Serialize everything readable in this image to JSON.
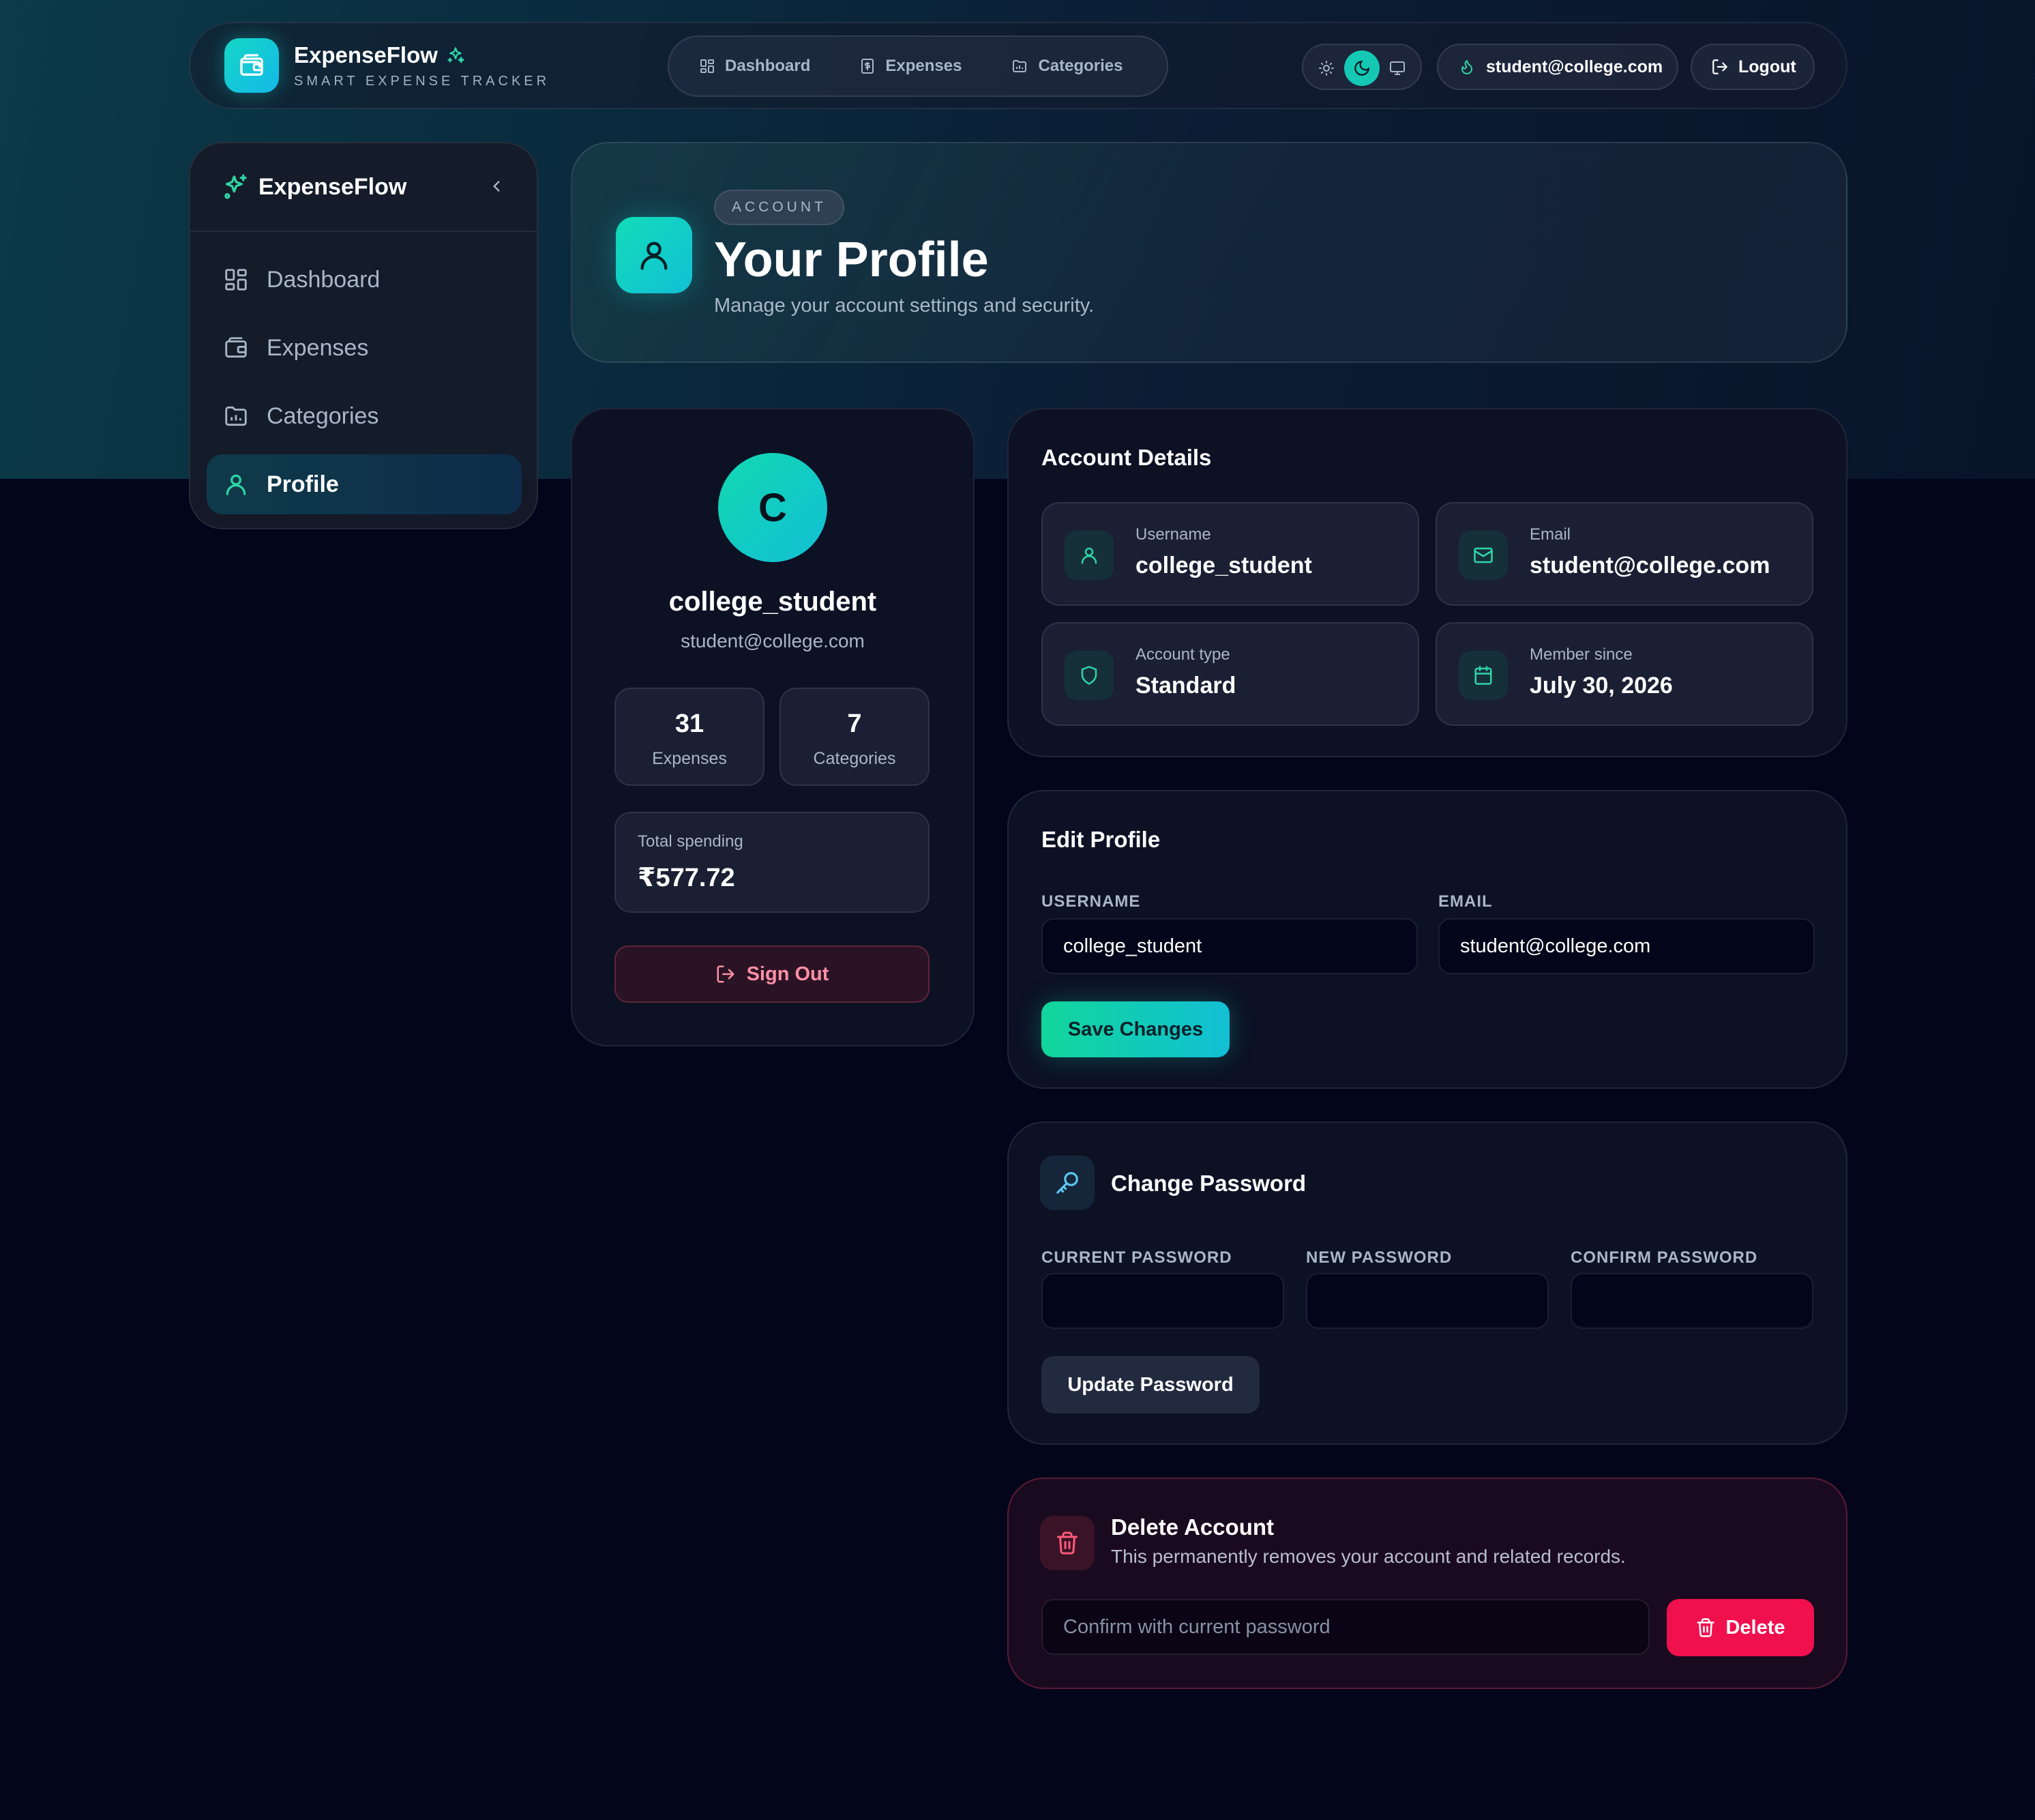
{
  "app": {
    "name": "ExpenseFlow",
    "tagline": "SMART EXPENSE TRACKER",
    "accent": "#14c8b4"
  },
  "topnav": {
    "items": [
      {
        "label": "Dashboard",
        "icon": "dashboard-icon"
      },
      {
        "label": "Expenses",
        "icon": "receipt-icon"
      },
      {
        "label": "Categories",
        "icon": "folder-chart-icon"
      }
    ]
  },
  "theme": {
    "options": [
      "sun-icon",
      "moon-icon",
      "monitor-icon"
    ],
    "selected": "dark"
  },
  "user": {
    "email": "student@college.com",
    "username": "college_student",
    "initial": "C"
  },
  "topbar": {
    "logout_label": "Logout"
  },
  "sidebar": {
    "brand": "ExpenseFlow",
    "items": [
      {
        "label": "Dashboard",
        "icon": "dashboard-icon"
      },
      {
        "label": "Expenses",
        "icon": "wallet-icon"
      },
      {
        "label": "Categories",
        "icon": "folder-chart-icon"
      },
      {
        "label": "Profile",
        "icon": "user-icon",
        "active": true
      }
    ]
  },
  "header": {
    "badge": "ACCOUNT",
    "title": "Your Profile",
    "subtitle": "Manage your account settings and security."
  },
  "profile": {
    "stats": [
      {
        "value": "31",
        "label": "Expenses"
      },
      {
        "value": "7",
        "label": "Categories"
      }
    ],
    "spending_label": "Total spending",
    "spending_value": "₹577.72",
    "signout_label": "Sign Out"
  },
  "account_details": {
    "title": "Account Details",
    "items": [
      {
        "label": "Username",
        "value": "college_student",
        "icon": "user-icon"
      },
      {
        "label": "Email",
        "value": "student@college.com",
        "icon": "mail-icon"
      },
      {
        "label": "Account type",
        "value": "Standard",
        "icon": "shield-icon"
      },
      {
        "label": "Member since",
        "value": "July 30, 2026",
        "icon": "calendar-icon"
      }
    ]
  },
  "edit_profile": {
    "title": "Edit Profile",
    "username_label": "USERNAME",
    "username_value": "college_student",
    "email_label": "EMAIL",
    "email_value": "student@college.com",
    "save_label": "Save Changes"
  },
  "change_password": {
    "title": "Change Password",
    "current_label": "CURRENT PASSWORD",
    "new_label": "NEW PASSWORD",
    "confirm_label": "CONFIRM PASSWORD",
    "update_label": "Update Password"
  },
  "delete_account": {
    "title": "Delete Account",
    "description": "This permanently removes your account and related records.",
    "placeholder": "Confirm with current password",
    "delete_label": "Delete",
    "danger_color": "#f0104e"
  }
}
